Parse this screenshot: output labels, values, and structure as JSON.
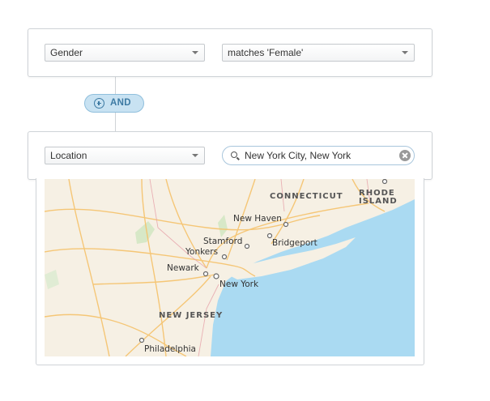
{
  "filters": [
    {
      "field": "Gender",
      "condition": "matches 'Female'"
    },
    {
      "field": "Location",
      "search_value": "New York City, New York"
    }
  ],
  "and_button": {
    "label": "AND"
  },
  "map": {
    "states": [
      "CONNECTICUT",
      "RHODE",
      "ISLAND",
      "NEW JERSEY"
    ],
    "cities": [
      "New Haven",
      "Stamford",
      "Bridgeport",
      "Yonkers",
      "Newark",
      "New York",
      "Philadelphia"
    ]
  },
  "colors": {
    "accent": "#3d7aa3",
    "and_bg": "#c8e2f2",
    "water": "#aadaf2",
    "land": "#f6f0e4"
  }
}
